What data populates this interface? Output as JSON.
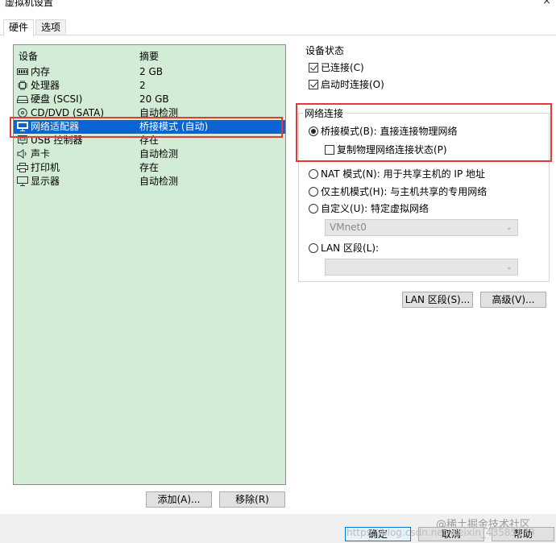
{
  "window": {
    "title": "虚拟机设置",
    "close_glyph": "×"
  },
  "tabs": [
    {
      "label": "硬件"
    },
    {
      "label": "选项"
    }
  ],
  "device_list": {
    "headers": {
      "device": "设备",
      "summary": "摘要"
    },
    "rows": [
      {
        "device": "内存",
        "summary": "2 GB",
        "icon": "memory-icon"
      },
      {
        "device": "处理器",
        "summary": "2",
        "icon": "cpu-icon"
      },
      {
        "device": "硬盘 (SCSI)",
        "summary": "20 GB",
        "icon": "hard-disk-icon"
      },
      {
        "device": "CD/DVD (SATA)",
        "summary": "自动检测",
        "icon": "cd-dvd-icon"
      },
      {
        "device": "网络适配器",
        "summary": "桥接模式 (自动)",
        "icon": "network-adapter-icon",
        "selected": true
      },
      {
        "device": "USB 控制器",
        "summary": "存在",
        "icon": "usb-icon"
      },
      {
        "device": "声卡",
        "summary": "自动检测",
        "icon": "speaker-icon"
      },
      {
        "device": "打印机",
        "summary": "存在",
        "icon": "printer-icon"
      },
      {
        "device": "显示器",
        "summary": "自动检测",
        "icon": "monitor-icon"
      }
    ],
    "add_button": "添加(A)...",
    "remove_button": "移除(R)"
  },
  "device_status": {
    "title": "设备状态",
    "connected": {
      "label": "已连接(C)",
      "checked": true
    },
    "connect_on_power_on": {
      "label": "启动时连接(O)",
      "checked": true
    }
  },
  "network_connection": {
    "title": "网络连接",
    "bridged": {
      "label": "桥接模式(B): 直接连接物理网络",
      "selected": true
    },
    "replicate_state": {
      "label": "复制物理网络连接状态(P)",
      "checked": false
    },
    "nat": {
      "label": "NAT 模式(N): 用于共享主机的 IP 地址",
      "selected": false
    },
    "host_only": {
      "label": "仅主机模式(H): 与主机共享的专用网络",
      "selected": false
    },
    "custom": {
      "label": "自定义(U): 特定虚拟网络",
      "selected": false
    },
    "custom_select_value": "VMnet0",
    "lan_segment": {
      "label": "LAN 区段(L):",
      "selected": false
    },
    "lan_select_value": ""
  },
  "right_buttons": {
    "lan_segments": "LAN 区段(S)...",
    "advanced": "高级(V)..."
  },
  "footer": {
    "ok": "确定",
    "cancel": "取消",
    "help": "帮助",
    "watermark_brand": "@稀土掘金技术社区",
    "watermark_url": "https://blog.csdn.net/weixin_43585173"
  },
  "colors": {
    "list_bg": "#d2ecd6",
    "selection": "#0a64d2",
    "highlight": "#e53935"
  }
}
